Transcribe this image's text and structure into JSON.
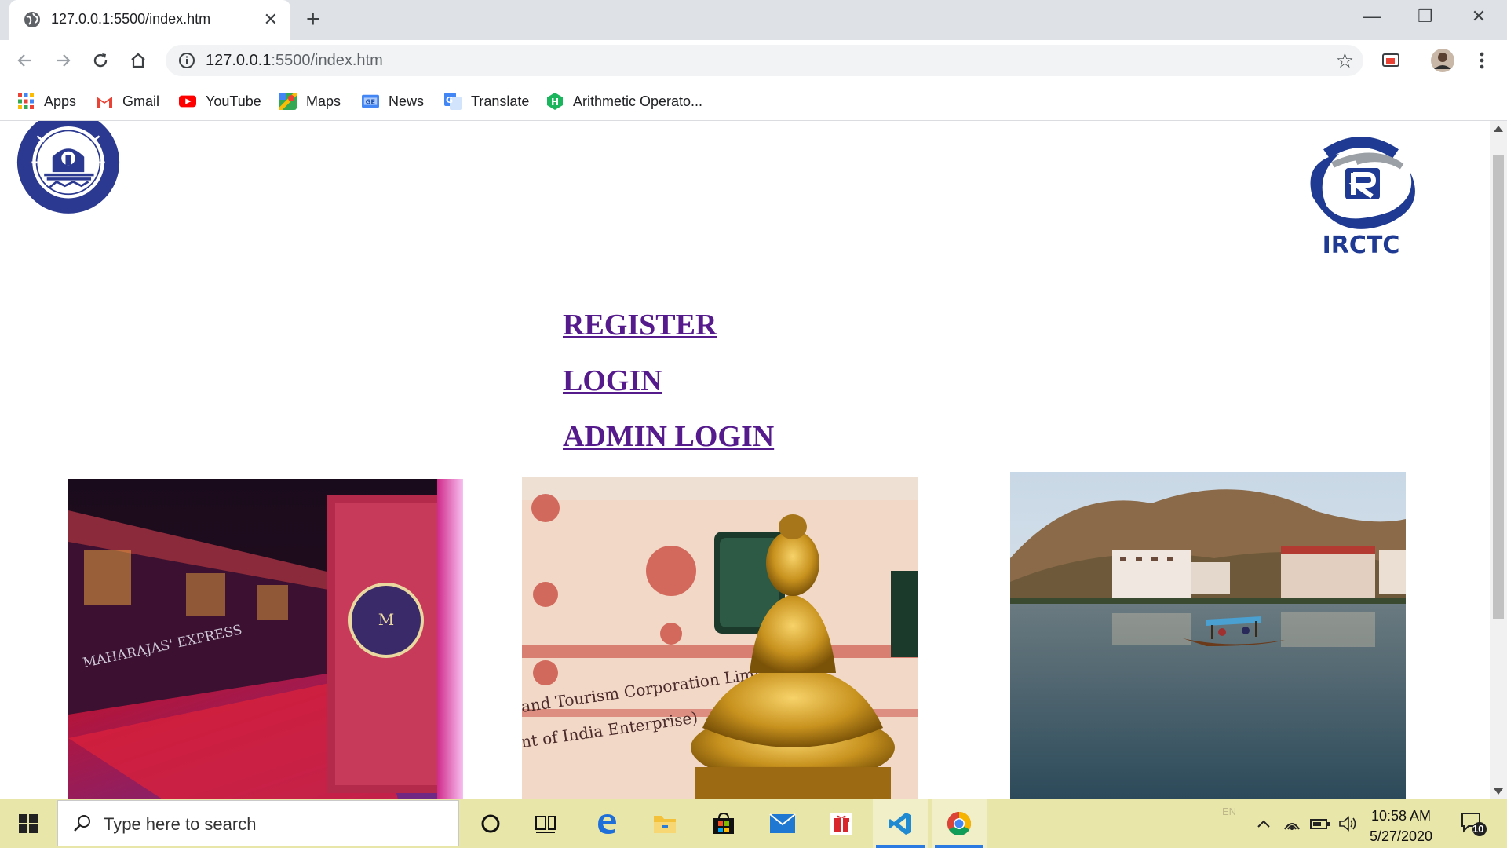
{
  "browser": {
    "tab_title": "127.0.0.1:5500/index.htm",
    "tab_close": "✕",
    "new_tab": "+",
    "window_controls": {
      "minimize": "—",
      "restore": "❐",
      "close": "✕"
    },
    "url_host": "127.0.0.1",
    "url_path": ":5500/index.htm",
    "bookmarks": [
      {
        "label": "Apps",
        "icon": "apps-grid-icon"
      },
      {
        "label": "Gmail",
        "icon": "gmail-icon"
      },
      {
        "label": "YouTube",
        "icon": "youtube-icon"
      },
      {
        "label": "Maps",
        "icon": "maps-icon"
      },
      {
        "label": "News",
        "icon": "news-icon"
      },
      {
        "label": "Translate",
        "icon": "translate-icon"
      },
      {
        "label": "Arithmetic Operato...",
        "icon": "hyperskill-icon"
      }
    ]
  },
  "page": {
    "logo_left": "Indian Railways emblem",
    "logo_right_text": "IRCTC",
    "links": {
      "register": "REGISTER",
      "login": "LOGIN",
      "admin_login": "ADMIN LOGIN"
    },
    "photos": [
      {
        "subject": "Maharajas' Express train at platform",
        "banner": "MAHARAJAS' EXPRESS"
      },
      {
        "subject": "Golden Buddha statue in front of tourist train",
        "caption_on_train": "and Tourism Corporation Limited / nt of India Enterprise)"
      },
      {
        "subject": "Dal Lake with shikara boat and hills"
      }
    ],
    "colors": {
      "link": "#551a8b",
      "emblem_blue": "#2b3990",
      "irctc_blue": "#1f3a93"
    }
  },
  "taskbar": {
    "search_placeholder": "Type here to search",
    "language": "EN",
    "time": "10:58 AM",
    "date": "5/27/2020",
    "notification_count": "10",
    "apps": [
      "cortana-icon",
      "task-view-icon",
      "edge-icon",
      "file-explorer-icon",
      "store-icon",
      "mail-icon",
      "gift-app-icon",
      "vscode-icon",
      "chrome-icon"
    ]
  }
}
